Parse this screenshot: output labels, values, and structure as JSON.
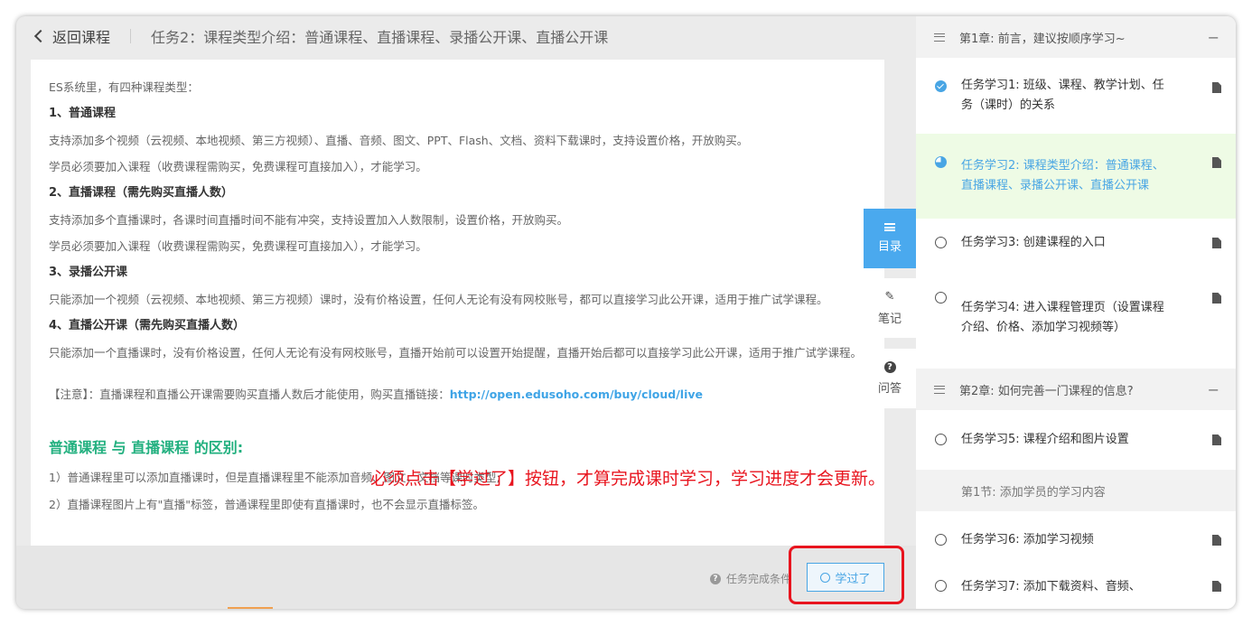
{
  "header": {
    "back_label": "返回课程",
    "task_title": "任务2：课程类型介绍：普通课程、直播课程、录播公开课、直播公开课"
  },
  "content": {
    "paragraphs": [
      {
        "text": "ES系统里，有四种课程类型：",
        "bold": false
      },
      {
        "text": "1、普通课程",
        "bold": true
      },
      {
        "text": "支持添加多个视频（云视频、本地视频、第三方视频）、直播、音频、图文、PPT、Flash、文档、资料下载课时，支持设置价格，开放购买。",
        "bold": false
      },
      {
        "text": "学员必须要加入课程（收费课程需购买，免费课程可直接加入），才能学习。",
        "bold": false
      },
      {
        "text": "2、直播课程（需先购买直播人数）",
        "bold": true
      },
      {
        "text": "支持添加多个直播课时，各课时间直播时间不能有冲突，支持设置加入人数限制，设置价格，开放购买。",
        "bold": false
      },
      {
        "text": "学员必须要加入课程（收费课程需购买，免费课程可直接加入），才能学习。",
        "bold": false
      },
      {
        "text": "3、录播公开课",
        "bold": true
      },
      {
        "text": "只能添加一个视频（云视频、本地视频、第三方视频）课时，没有价格设置，任何人无论有没有网校账号，都可以直接学习此公开课，适用于推广试学课程。",
        "bold": false
      },
      {
        "text": "4、直播公开课（需先购买直播人数）",
        "bold": true
      },
      {
        "text": "只能添加一个直播课时，没有价格设置，任何人无论有没有网校账号，直播开始前可以设置开始提醒，直播开始后都可以直接学习此公开课，适用于推广试学课程。",
        "bold": false
      }
    ],
    "note_prefix": "【注意】：直播课程和直播公开课需要购买直播人数后才能使用，购买直播链接：",
    "note_link": "http://open.edusoho.com/buy/cloud/live",
    "diff_title": "普通课程 与 直播课程 的区别:",
    "diff_items": [
      "1）普通课程里可以添加直播课时，但是直播课程里不能添加音频、图文、文档等课时类型;",
      "2）直播课程图片上有\"直播\"标签，普通课程里即使有直播课时，也不会显示直播标签。"
    ]
  },
  "bottom": {
    "condition_label": "任务完成条件",
    "learned_button": "学过了"
  },
  "annotation": "必须点击【学过了】按钮，才算完成课时学习，学习进度才会更新。",
  "side_tabs": {
    "directory": "目录",
    "notes": "笔记",
    "qa": "问答"
  },
  "sidebar": {
    "chapter1": "第1章: 前言，建议按顺序学习~",
    "lessons_ch1": [
      {
        "label": "任务学习1: 班级、课程、教学计划、任务（课时）的关系",
        "status": "done",
        "active": false
      },
      {
        "label": "任务学习2: 课程类型介绍：普通课程、直播课程、录播公开课、直播公开课",
        "status": "half",
        "active": true
      },
      {
        "label": "任务学习3: 创建课程的入口",
        "status": "todo",
        "active": false
      },
      {
        "label": "任务学习4: 进入课程管理页（设置课程介绍、价格、添加学习视频等）",
        "status": "todo",
        "active": false
      }
    ],
    "chapter2": "第2章: 如何完善一门课程的信息?",
    "lesson5": "任务学习5: 课程介绍和图片设置",
    "section1": "第1节: 添加学员的学习内容",
    "lesson6": "任务学习6: 添加学习视频",
    "lesson7": "任务学习7: 添加下载资料、音频、"
  },
  "colors": {
    "accent": "#48a5e4",
    "active_bg": "#eefbe5",
    "annotation_red": "#e8141e",
    "green_title": "#22b07f"
  }
}
